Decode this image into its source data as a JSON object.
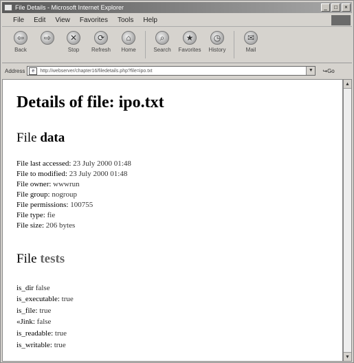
{
  "window": {
    "title": "File Details - Microsoft Internet Explorer",
    "controls": [
      "_",
      "□",
      "×"
    ]
  },
  "menu": {
    "items": [
      "File",
      "Edit",
      "View",
      "Favorites",
      "Tools",
      "Help"
    ]
  },
  "toolbar": {
    "buttons": [
      {
        "label": "Back",
        "icon": "back-arrow-icon",
        "glyph": "⇦"
      },
      {
        "label": "",
        "icon": "forward-arrow-icon",
        "glyph": "⇨"
      },
      {
        "label": "Stop",
        "icon": "stop-icon",
        "glyph": "✕"
      },
      {
        "label": "Refresh",
        "icon": "refresh-icon",
        "glyph": "⟳"
      },
      {
        "label": "Home",
        "icon": "home-icon",
        "glyph": "⌂"
      },
      {
        "label": "Search",
        "icon": "search-icon",
        "glyph": "⌕"
      },
      {
        "label": "Favorites",
        "icon": "favorites-icon",
        "glyph": "★"
      },
      {
        "label": "History",
        "icon": "history-icon",
        "glyph": "◷"
      },
      {
        "label": "Mail",
        "icon": "mail-icon",
        "glyph": "✉"
      }
    ]
  },
  "address": {
    "label": "Address",
    "url": "http://webserver/chapter16/filedetails.php?file=ipo.txt",
    "go_label": "Go"
  },
  "page": {
    "heading": "Details of file: ipo.txt",
    "data_section": {
      "prefix": "File",
      "bold": "data"
    },
    "details": [
      {
        "label": "File last accessed:",
        "value": "23 July 2000 01:48"
      },
      {
        "label": "File to modified:",
        "value": "23 July 2000 01:48"
      },
      {
        "label": "File owner:",
        "value": "wwwrun"
      },
      {
        "label": "File group:",
        "value": "nogroup"
      },
      {
        "label": "File permissions:",
        "value": "100755"
      },
      {
        "label": "File type:",
        "value": "fie"
      },
      {
        "label": "File size:",
        "value": "206 bytes"
      }
    ],
    "tests_section": {
      "prefix": "File",
      "bold": "tests"
    },
    "tests": [
      {
        "label": "is_dir",
        "value": "false"
      },
      {
        "label": "is_executable:",
        "value": "true"
      },
      {
        "label": "is_file:",
        "value": "true"
      },
      {
        "label": "«Jink:",
        "value": "false"
      },
      {
        "label": "is_readable:",
        "value": "true"
      },
      {
        "label": "is_writable:",
        "value": "true"
      }
    ]
  }
}
